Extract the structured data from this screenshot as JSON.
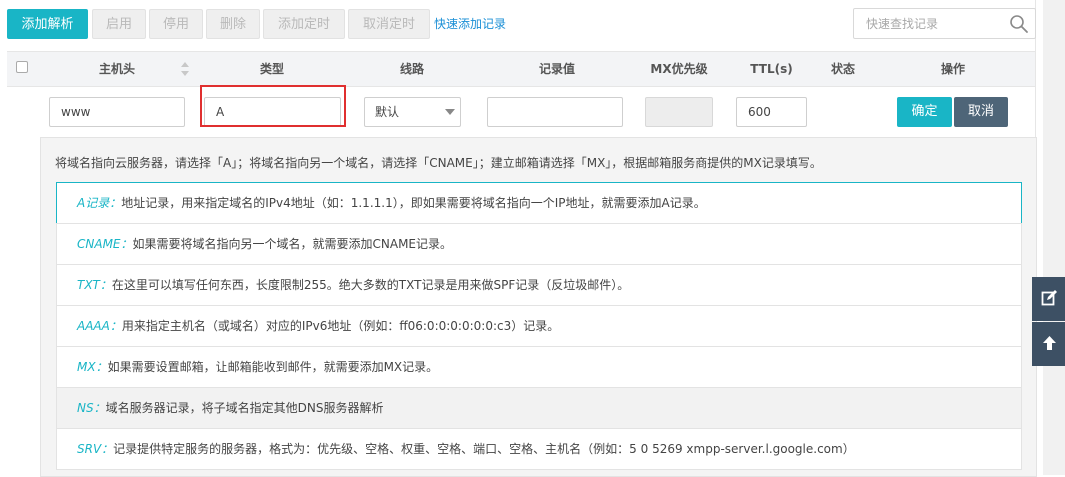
{
  "toolbar": {
    "buttons": [
      {
        "label": "添加解析",
        "enabled": true
      },
      {
        "label": "启用",
        "enabled": false
      },
      {
        "label": "停用",
        "enabled": false
      },
      {
        "label": "删除",
        "enabled": false
      },
      {
        "label": "添加定时",
        "enabled": false
      },
      {
        "label": "取消定时",
        "enabled": false
      }
    ],
    "quick_add_link": "快速添加记录",
    "search": {
      "placeholder": "快速查找记录",
      "value": ""
    }
  },
  "table": {
    "columns": [
      "主机头",
      "类型",
      "线路",
      "记录值",
      "MX优先级",
      "TTL(s)",
      "状态",
      "操作"
    ]
  },
  "edit_row": {
    "host": "www",
    "type": "A",
    "line": "默认",
    "value": "",
    "mx_priority": "",
    "ttl": "600",
    "confirm_label": "确定",
    "cancel_label": "取消"
  },
  "hint_panel": {
    "intro": "将域名指向云服务器，请选择「A」；将域名指向另一个域名，请选择「CNAME」；建立邮箱请选择「MX」，根据邮箱服务商提供的MX记录填写。",
    "items": [
      {
        "type": "A记录：",
        "text": "地址记录，用来指定域名的IPv4地址（如：1.1.1.1），即如果需要将域名指向一个IP地址，就需要添加A记录。"
      },
      {
        "type": "CNAME：",
        "text": "如果需要将域名指向另一个域名，就需要添加CNAME记录。"
      },
      {
        "type": "TXT：",
        "text": "在这里可以填写任何东西，长度限制255。绝大多数的TXT记录是用来做SPF记录（反垃圾邮件）。"
      },
      {
        "type": "AAAA：",
        "text": "用来指定主机名（或域名）对应的IPv6地址（例如：ff06:0:0:0:0:0:0:c3）记录。"
      },
      {
        "type": "MX：",
        "text": "如果需要设置邮箱，让邮箱能收到邮件，就需要添加MX记录。"
      },
      {
        "type": "NS：",
        "text": "域名服务器记录，将子域名指定其他DNS服务器解析"
      },
      {
        "type": "SRV：",
        "text": "记录提供特定服务的服务器，格式为：优先级、空格、权重、空格、端口、空格、主机名（例如：5 0 5269 xmpp-server.l.google.com）"
      }
    ]
  },
  "colors": {
    "accent": "#19b5c6",
    "cancel": "#4e6578",
    "highlight": "#e02f2f",
    "link": "#1a8fd6",
    "float_widget": "#3d5064"
  },
  "icons": {
    "search": "search-icon",
    "sort": "sort-icon",
    "select_caret": "chevron-down-icon",
    "float_top": "edit-icon",
    "float_bottom": "arrow-up-icon"
  }
}
